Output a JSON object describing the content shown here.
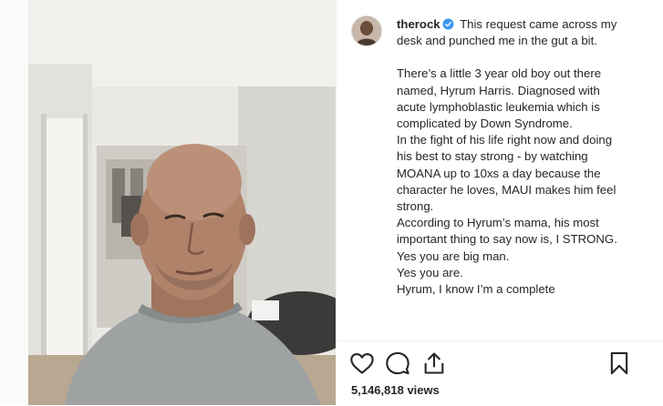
{
  "post": {
    "username": "therock",
    "verified": true,
    "caption_first": "This request came across my desk and punched me in the gut a bit.",
    "caption_lines": [
      "There’s a little 3 year old boy out there named, Hyrum Harris. Diagnosed with acute lymphoblastic leukemia which is complicated by Down Syndrome.",
      "In the fight of his life right now and doing his best to stay strong - by watching MOANA up to 10xs a day because the character he loves, MAUI makes him feel strong.",
      "According to Hyrum’s mama, his most important thing to say now is, I STRONG.",
      "Yes you are big man.",
      "Yes you are.",
      "Hyrum, I know I’m a complete"
    ],
    "views": "5,146,818 views"
  },
  "icons": {
    "like": "heart-icon",
    "comment": "comment-icon",
    "share": "share-icon",
    "save": "bookmark-icon"
  },
  "colors": {
    "verified": "#3897f0",
    "text": "#262626",
    "border": "#efefef"
  }
}
